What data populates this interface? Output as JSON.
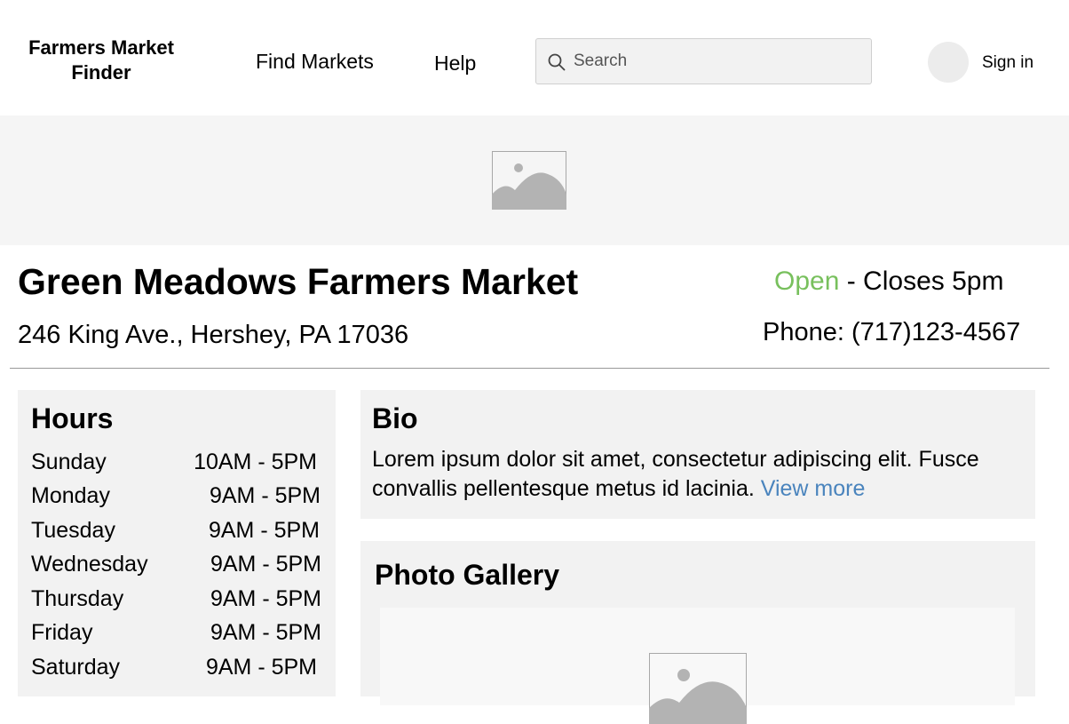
{
  "header": {
    "logo_text": "Farmers Market Finder",
    "nav": [
      "Find Markets",
      "Help"
    ],
    "search": {
      "placeholder": "Search",
      "value": ""
    },
    "sign_in": "Sign in"
  },
  "market": {
    "name": "Green Meadows Farmers Market",
    "status": "Open",
    "status_detail": " - Closes 5pm",
    "address": "246 King Ave., Hershey, PA 17036",
    "phone": "Phone: (717)123-4567"
  },
  "hours": {
    "title": "Hours",
    "rows": [
      {
        "day": "Sunday",
        "time": "10AM - 5PM"
      },
      {
        "day": "Monday",
        "time": "9AM - 5PM"
      },
      {
        "day": "Tuesday",
        "time": "9AM - 5PM"
      },
      {
        "day": "Wednesday",
        "time": "9AM - 5PM"
      },
      {
        "day": "Thursday",
        "time": "9AM - 5PM"
      },
      {
        "day": "Friday",
        "time": "9AM - 5PM"
      },
      {
        "day": "Saturday",
        "time": "9AM - 5PM"
      }
    ]
  },
  "bio": {
    "title": "Bio",
    "text": "Lorem ipsum dolor sit amet, consectetur adipiscing elit. Fusce convallis pellentesque metus id lacinia. ",
    "link": "View more"
  },
  "gallery": {
    "title": "Photo Gallery"
  },
  "icons": {
    "search": "search-icon",
    "hero_image": "image-placeholder-icon",
    "gallery_image": "image-placeholder-icon",
    "avatar": "avatar"
  },
  "colors": {
    "open": "#78c05d",
    "link": "#4a84bd"
  }
}
